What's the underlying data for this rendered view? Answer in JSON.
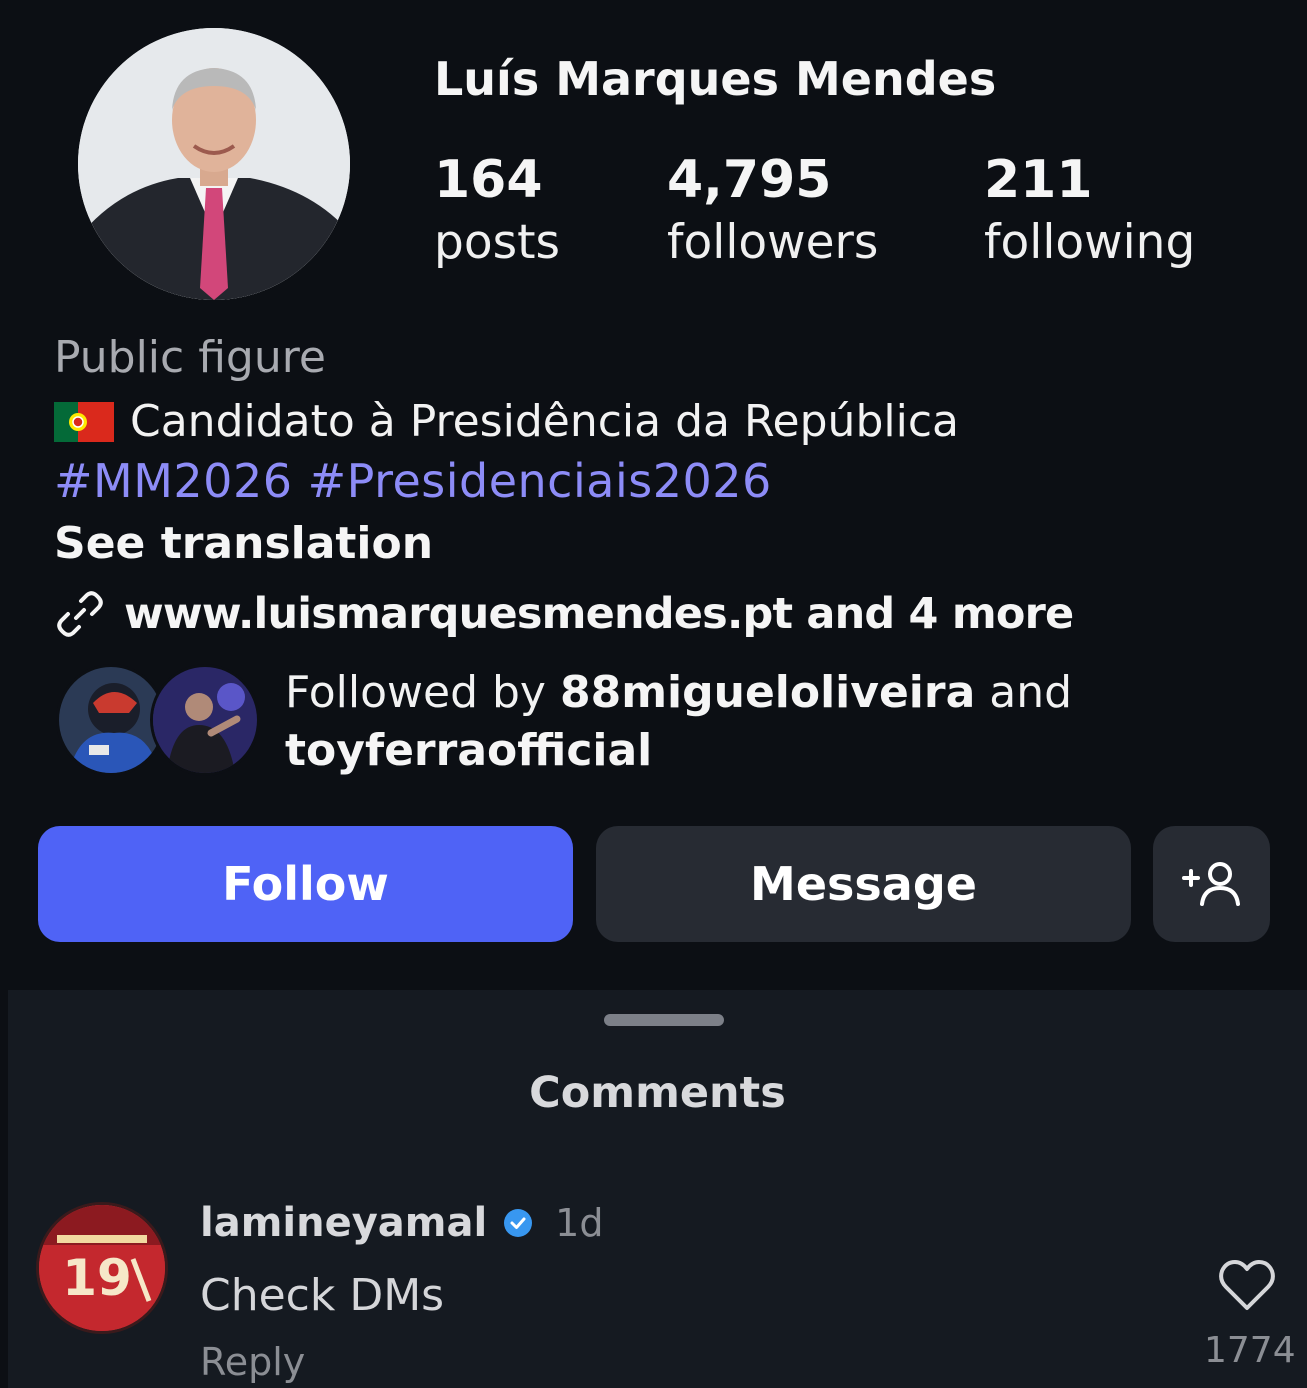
{
  "profile": {
    "name": "Luís Marques Mendes",
    "stats": {
      "posts": {
        "value": "164",
        "label": "posts"
      },
      "followers": {
        "value": "4,795",
        "label": "followers"
      },
      "following": {
        "value": "211",
        "label": "following"
      }
    },
    "category": "Public figure",
    "bio_line": "Candidato à Presidência da República",
    "hashtags": "#MM2026 #Presidenciais2026",
    "see_translation": "See translation",
    "link_text": "www.luismarquesmendes.pt and 4 more",
    "followed_by": {
      "prefix": "Followed by ",
      "user1": "88migueloliveira",
      "connector": " and ",
      "user2": "toyferraofficial"
    },
    "buttons": {
      "follow": "Follow",
      "message": "Message",
      "add_person": "+person-icon"
    }
  },
  "comments_sheet": {
    "title": "Comments",
    "comment": {
      "username": "lamineyamal",
      "time": "1d",
      "text": "Check DMs",
      "reply": "Reply",
      "likes": "1774",
      "avatar_number": "19"
    }
  },
  "colors": {
    "background": "#0c0f14",
    "follow_button": "#4f63f6",
    "secondary_button": "#272b33",
    "hashtag": "#8d8cf7",
    "verified": "#3897f0"
  }
}
